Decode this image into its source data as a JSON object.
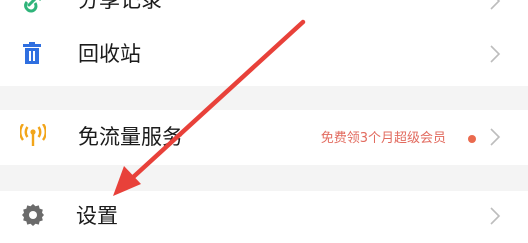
{
  "menu": {
    "items": [
      {
        "label": "分享记录",
        "icon": "share-link-icon"
      },
      {
        "label": "回收站",
        "icon": "trash-icon"
      },
      {
        "label": "免流量服务",
        "icon": "signal-tower-icon",
        "promo": "免费领3个月超级会员",
        "badge": "red-dot"
      },
      {
        "label": "设置",
        "icon": "gear-icon"
      }
    ]
  },
  "colors": {
    "share_icon": "#2fb47a",
    "trash_icon": "#2f6fe0",
    "signal_icon": "#f2a51a",
    "gear_icon": "#6b6b6b",
    "promo_text": "#e26b5f",
    "dot": "#ea6a4e",
    "arrow": "#e8413a",
    "section_gap": "#f4f4f4"
  }
}
